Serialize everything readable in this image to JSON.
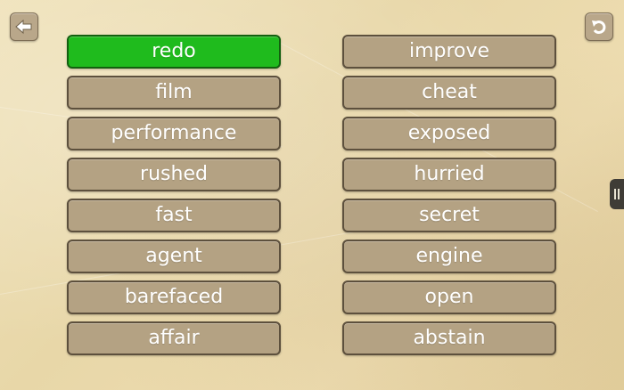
{
  "header": {
    "back_icon": "back-arrow-icon",
    "undo_icon": "undo-icon"
  },
  "colors": {
    "selected": "#1fbb1d",
    "tile": "#b4a283"
  },
  "left_words": [
    {
      "label": "redo",
      "selected": true
    },
    {
      "label": "film",
      "selected": false
    },
    {
      "label": "performance",
      "selected": false
    },
    {
      "label": "rushed",
      "selected": false
    },
    {
      "label": "fast",
      "selected": false
    },
    {
      "label": "agent",
      "selected": false
    },
    {
      "label": "barefaced",
      "selected": false
    },
    {
      "label": "affair",
      "selected": false
    }
  ],
  "right_words": [
    {
      "label": "improve",
      "selected": false
    },
    {
      "label": "cheat",
      "selected": false
    },
    {
      "label": "exposed",
      "selected": false
    },
    {
      "label": "hurried",
      "selected": false
    },
    {
      "label": "secret",
      "selected": false
    },
    {
      "label": "engine",
      "selected": false
    },
    {
      "label": "open",
      "selected": false
    },
    {
      "label": "abstain",
      "selected": false
    }
  ],
  "side_panel": {
    "icon": "drawer-handle-icon"
  }
}
